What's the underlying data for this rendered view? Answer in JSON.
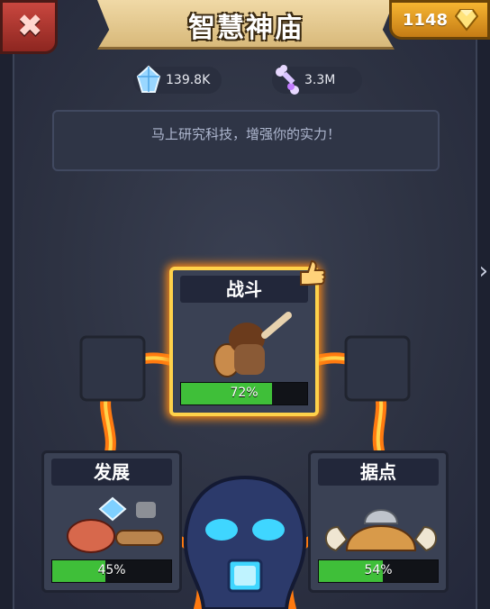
{
  "header": {
    "title": "智慧神庙",
    "gems": "1148"
  },
  "resources": {
    "crystal": "139.8K",
    "bone": "3.3M"
  },
  "message": "马上研究科技，增强你的实力！",
  "techs": [
    {
      "name": "战斗",
      "progress": 72,
      "progress_label": "72%"
    },
    {
      "name": "发展",
      "progress": 45,
      "progress_label": "45%"
    },
    {
      "name": "据点",
      "progress": 54,
      "progress_label": "54%"
    }
  ],
  "colors": {
    "accent": "#ffd24a",
    "progress": "#3fbf39",
    "lava": "#ff8a16"
  }
}
